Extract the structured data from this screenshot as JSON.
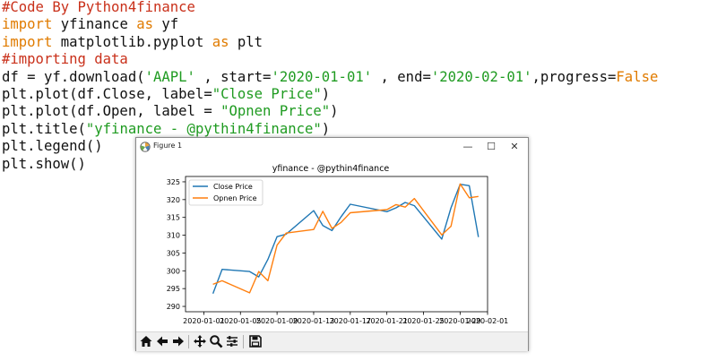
{
  "code": {
    "line1": "#Code By Python4finance",
    "line2_kw": "import",
    "line2_rest": " yfinance ",
    "line2_as": "as",
    "line2_alias": " yf",
    "line3_kw": "import",
    "line3_rest": " matplotlib.pyplot ",
    "line3_as": "as",
    "line3_alias": " plt",
    "line4": "#importing data",
    "line5_a": "df = yf.download(",
    "line5_ticker": "'AAPL'",
    "line5_b": " , start=",
    "line5_start": "'2020-01-01'",
    "line5_c": " , end=",
    "line5_end": "'2020-02-01'",
    "line5_d": ",progress=",
    "line5_false": "False",
    "line6_a": "plt.plot(df.Close, label=",
    "line6_str": "\"Close Price\"",
    "line6_b": ")",
    "line7_a": "plt.plot(df.Open, label = ",
    "line7_str": "\"Opnen Price\"",
    "line7_b": ")",
    "line8_a": "plt.title(",
    "line8_str": "\"yfinance - @pythin4finance\"",
    "line8_b": ")",
    "line9": "plt.legend()",
    "line10": "plt.show()"
  },
  "window": {
    "title": "Figure 1",
    "minimize_glyph": "—",
    "maximize_glyph": "☐",
    "close_glyph": "✕"
  },
  "toolbar": {
    "buttons": [
      "home-icon",
      "back-arrow-icon",
      "forward-arrow-icon",
      "pan-icon",
      "zoom-icon",
      "configure-subplots-icon",
      "save-icon"
    ]
  },
  "chart_data": {
    "type": "line",
    "title": "yfinance - @pythin4finance",
    "xlabel": "",
    "ylabel": "",
    "x_type": "date",
    "x_range": [
      "2019-12-30",
      "2020-02-01"
    ],
    "ylim": [
      288.5,
      326.5
    ],
    "yticks": [
      290,
      295,
      300,
      305,
      310,
      315,
      320,
      325
    ],
    "xtick_labels": [
      "2020-01-01",
      "2020-01-05",
      "2020-01-09",
      "2020-01-13",
      "2020-01-17",
      "2020-01-21",
      "2020-01-25",
      "2020-01-29",
      "2020-02-01"
    ],
    "xtick_dates": [
      "2020-01-01",
      "2020-01-05",
      "2020-01-09",
      "2020-01-13",
      "2020-01-17",
      "2020-01-21",
      "2020-01-25",
      "2020-01-29",
      "2020-02-01"
    ],
    "grid": false,
    "legend": "upper-left",
    "series": [
      {
        "name": "Close Price",
        "color": "#1f77b4",
        "x": [
          "2020-01-02",
          "2020-01-03",
          "2020-01-06",
          "2020-01-07",
          "2020-01-08",
          "2020-01-09",
          "2020-01-10",
          "2020-01-13",
          "2020-01-14",
          "2020-01-15",
          "2020-01-16",
          "2020-01-17",
          "2020-01-21",
          "2020-01-22",
          "2020-01-23",
          "2020-01-24",
          "2020-01-27",
          "2020-01-28",
          "2020-01-29",
          "2020-01-30",
          "2020-01-31"
        ],
        "values": [
          293.6,
          300.4,
          299.8,
          298.3,
          303.2,
          309.6,
          310.3,
          316.9,
          312.7,
          311.3,
          315.2,
          318.7,
          316.6,
          317.7,
          319.2,
          318.3,
          308.9,
          317.7,
          324.3,
          323.9,
          309.5
        ]
      },
      {
        "name": "Opnen Price",
        "color": "#ff7f0e",
        "x": [
          "2020-01-02",
          "2020-01-03",
          "2020-01-06",
          "2020-01-07",
          "2020-01-08",
          "2020-01-09",
          "2020-01-10",
          "2020-01-13",
          "2020-01-14",
          "2020-01-15",
          "2020-01-16",
          "2020-01-17",
          "2020-01-21",
          "2020-01-22",
          "2020-01-23",
          "2020-01-24",
          "2020-01-27",
          "2020-01-28",
          "2020-01-29",
          "2020-01-30",
          "2020-01-31"
        ],
        "values": [
          296.2,
          297.2,
          293.8,
          299.8,
          297.2,
          307.2,
          310.6,
          311.6,
          316.7,
          311.9,
          313.6,
          316.3,
          317.2,
          318.6,
          317.9,
          320.3,
          310.1,
          312.5,
          324.4,
          320.5,
          320.9
        ]
      }
    ]
  }
}
